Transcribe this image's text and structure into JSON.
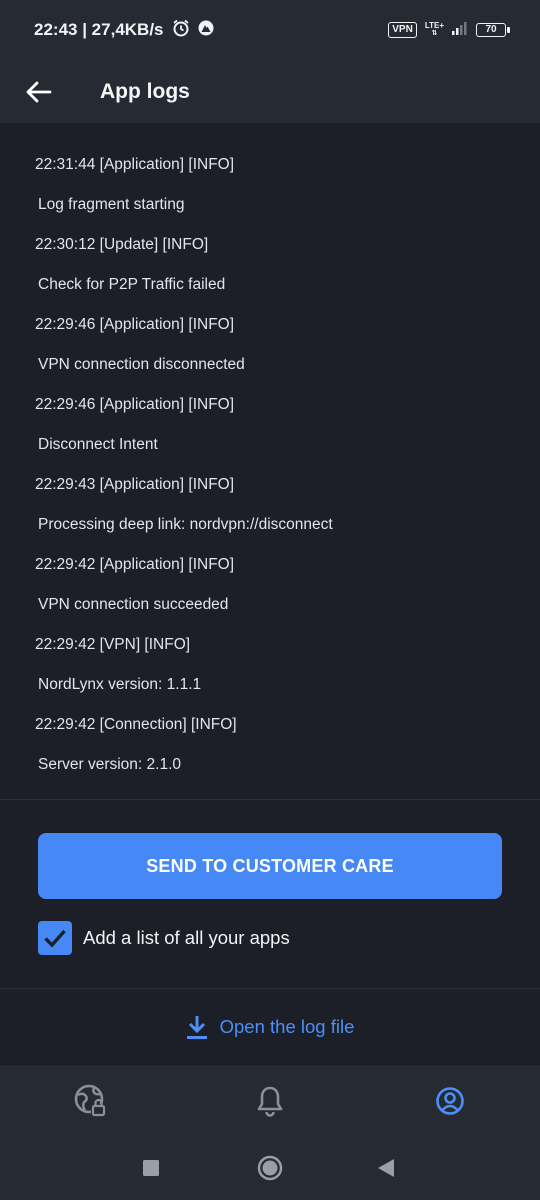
{
  "status_bar": {
    "time_speed": "22:43 | 27,4KB/s",
    "vpn": "VPN",
    "network": "LTE+",
    "battery": "70",
    "icons": [
      "alarm-icon",
      "nord-icon",
      "signal-icon"
    ]
  },
  "app_bar": {
    "title": "App logs",
    "back_icon": "arrow-left-icon"
  },
  "logs": [
    {
      "head": "22:31:44 [Application] [INFO]",
      "message": "Log fragment starting"
    },
    {
      "head": "22:30:12 [Update] [INFO]",
      "message": "Check for P2P Traffic failed"
    },
    {
      "head": "22:29:46 [Application] [INFO]",
      "message": "VPN connection disconnected"
    },
    {
      "head": "22:29:46 [Application] [INFO]",
      "message": "Disconnect Intent"
    },
    {
      "head": "22:29:43 [Application] [INFO]",
      "message": "Processing deep link: nordvpn://disconnect"
    },
    {
      "head": "22:29:42 [Application] [INFO]",
      "message": "VPN connection succeeded"
    },
    {
      "head": "22:29:42 [VPN] [INFO]",
      "message": "NordLynx version: 1.1.1"
    },
    {
      "head": "22:29:42 [Connection] [INFO]",
      "message": "Server version: 2.1.0"
    }
  ],
  "actions": {
    "send_label": "SEND TO CUSTOMER CARE",
    "checkbox_label": "Add a list of all your apps",
    "checkbox_checked": true,
    "open_log_label": "Open the log file"
  },
  "bottom_nav": [
    {
      "name": "globe-lock-icon",
      "active": false
    },
    {
      "name": "bell-icon",
      "active": false
    },
    {
      "name": "profile-icon",
      "active": true
    }
  ],
  "colors": {
    "background": "#1c1f28",
    "bar": "#262a33",
    "accent": "#4688f6",
    "icon_inactive": "#8b8f99"
  }
}
